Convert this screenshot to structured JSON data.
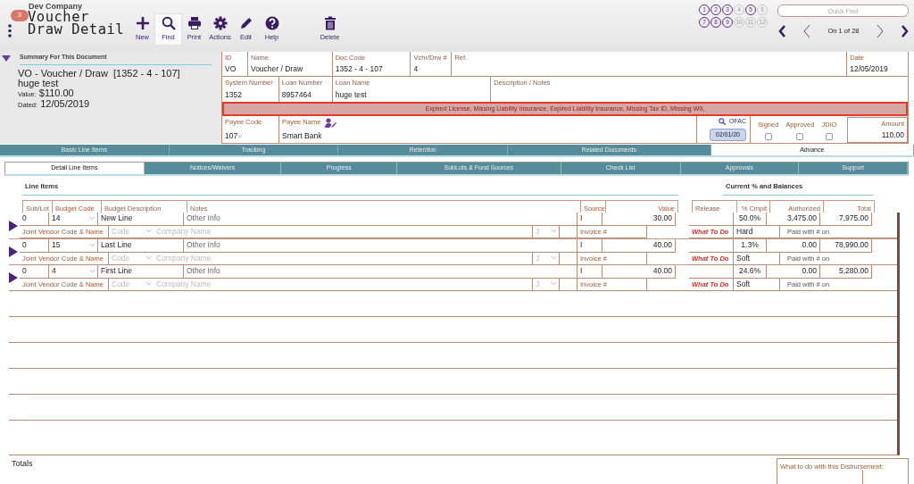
{
  "app": {
    "company": "Dev Company",
    "badge": "3",
    "title_lines": [
      "Voucher",
      "Draw Detail"
    ]
  },
  "toolbar": [
    {
      "label": "New",
      "selected": false
    },
    {
      "label": "Find",
      "selected": true
    },
    {
      "label": "Print",
      "selected": false
    },
    {
      "label": "Actions",
      "selected": false
    },
    {
      "label": "Edit",
      "selected": false
    },
    {
      "label": "Help",
      "selected": false
    },
    {
      "label": "Delete",
      "selected": false
    }
  ],
  "record_slots": [
    {
      "label": "1",
      "disabled": false
    },
    {
      "label": "2",
      "disabled": false
    },
    {
      "label": "3",
      "disabled": false
    },
    {
      "label": "4",
      "disabled": true
    },
    {
      "label": "5",
      "disabled": false
    },
    {
      "label": "6",
      "disabled": true
    },
    {
      "label": "7",
      "disabled": false
    },
    {
      "label": "8",
      "disabled": false
    },
    {
      "label": "9",
      "disabled": false
    },
    {
      "label": "10",
      "disabled": true
    },
    {
      "label": "11",
      "disabled": true
    },
    {
      "label": "12",
      "disabled": true
    }
  ],
  "quick_find": {
    "placeholder": "Quick Find"
  },
  "pager": {
    "text": "On 1 of 28"
  },
  "summary": {
    "heading": "Summary For This Document",
    "title": "VO - Voucher / Draw  [1352 - 4 - 107]",
    "subtitle": "huge test",
    "value_label": "Value:",
    "value": "$110.00",
    "dated_label": "Dated:",
    "dated": "12/05/2019"
  },
  "header_fields": [
    [
      {
        "label": "ID",
        "value": "VO"
      },
      {
        "label": "Name",
        "value": "Voucher / Draw"
      },
      {
        "label": "Doc Code",
        "value": "1352 - 4 - 107"
      },
      {
        "label": "Vchr/Drw #",
        "value": "4"
      },
      {
        "label": "Ref."
      },
      {
        "label": "Date",
        "value": "12/05/2019"
      }
    ],
    [
      {
        "label": "System Number",
        "value": "1352"
      },
      {
        "label": "Loan Number",
        "value": "8957464"
      },
      {
        "label": "Loan Name",
        "value": "huge test"
      },
      {
        "label": "Description / Notes"
      }
    ]
  ],
  "alert": "Expired License, Missing Liability Insurance, Expired Liability Insurance, Missing Tax ID, Missing W9,",
  "payee": {
    "code_label": "Payee Code",
    "code": "107",
    "name_label": "Payee Name",
    "name": "Smart Bank",
    "ofac": "OFAC",
    "ofac_date": "02/01/20",
    "checks": [
      {
        "label": "Signed",
        "checked": false
      },
      {
        "label": "Approved",
        "checked": false
      },
      {
        "label": "JDIO",
        "checked": false
      }
    ],
    "amount_label": "Amount",
    "amount": "110.00"
  },
  "main_tabs": [
    {
      "label": "Basic Line Items",
      "selected": false
    },
    {
      "label": "Tracking",
      "selected": false
    },
    {
      "label": "Retention",
      "selected": false
    },
    {
      "label": "Related Documents",
      "selected": false
    },
    {
      "label": "Advance",
      "selected": true
    }
  ],
  "sub_tabs": [
    {
      "label": "Detail Line Items",
      "selected": true
    },
    {
      "label": "Notices/Waivers",
      "selected": false
    },
    {
      "label": "Progress",
      "selected": false
    },
    {
      "label": "SubLots & Fund Sources",
      "selected": false
    },
    {
      "label": "Check List",
      "selected": false
    },
    {
      "label": "Approvals",
      "selected": false
    },
    {
      "label": "Support",
      "selected": false
    }
  ],
  "line_items": {
    "title": "Line Items",
    "columns": [
      "Sub/Lot",
      "Budget Code",
      "Budget Description",
      "Notes",
      "Source",
      "Value"
    ],
    "rows": [
      {
        "sub_lot": "0",
        "budget_code": "14",
        "description": "New Line",
        "notes": "Other Info",
        "source": "I",
        "value": "30.00",
        "joint_vendor_label": "Joint Vendor Code & Name",
        "code_placeholder": "Code",
        "company_placeholder": "Company Name",
        "j_label": "J",
        "invoice_placeholder": "Invoice #"
      },
      {
        "sub_lot": "0",
        "budget_code": "15",
        "description": "Last Line",
        "notes": "Other Info",
        "source": "I",
        "value": "40.00",
        "joint_vendor_label": "Joint Vendor Code & Name",
        "code_placeholder": "Code",
        "company_placeholder": "Company Name",
        "j_label": "J",
        "invoice_placeholder": "Invoice #"
      },
      {
        "sub_lot": "0",
        "budget_code": "4",
        "description": "First Line",
        "notes": "Other Info",
        "source": "I",
        "value": "40.00",
        "joint_vendor_label": "Joint Vendor Code & Name",
        "code_placeholder": "Code",
        "company_placeholder": "Company Name",
        "j_label": "J",
        "invoice_placeholder": "Invoice #"
      }
    ]
  },
  "balances": {
    "title": "Current % and Balances",
    "columns": [
      "Release",
      "% Cmplt",
      "Authorized",
      "Total"
    ],
    "rows": [
      {
        "pct": "50.0%",
        "authorized": "3,475.00",
        "total": "7,975.00",
        "what_to_do_label": "What To Do",
        "type": "Hard",
        "paid_label": "Paid with #",
        "on_label": "on"
      },
      {
        "pct": "1.3%",
        "authorized": "0.00",
        "total": "78,990.00",
        "what_to_do_label": "What To Do",
        "type": "Soft",
        "paid_label": "Paid with #",
        "on_label": "on"
      },
      {
        "pct": "24.6%",
        "authorized": "0.00",
        "total": "5,280.00",
        "what_to_do_label": "What To Do",
        "type": "Soft",
        "paid_label": "Paid with #",
        "on_label": "on"
      }
    ]
  },
  "totals_label": "Totals",
  "disbursement_label": "What to do with this Disbursement:"
}
